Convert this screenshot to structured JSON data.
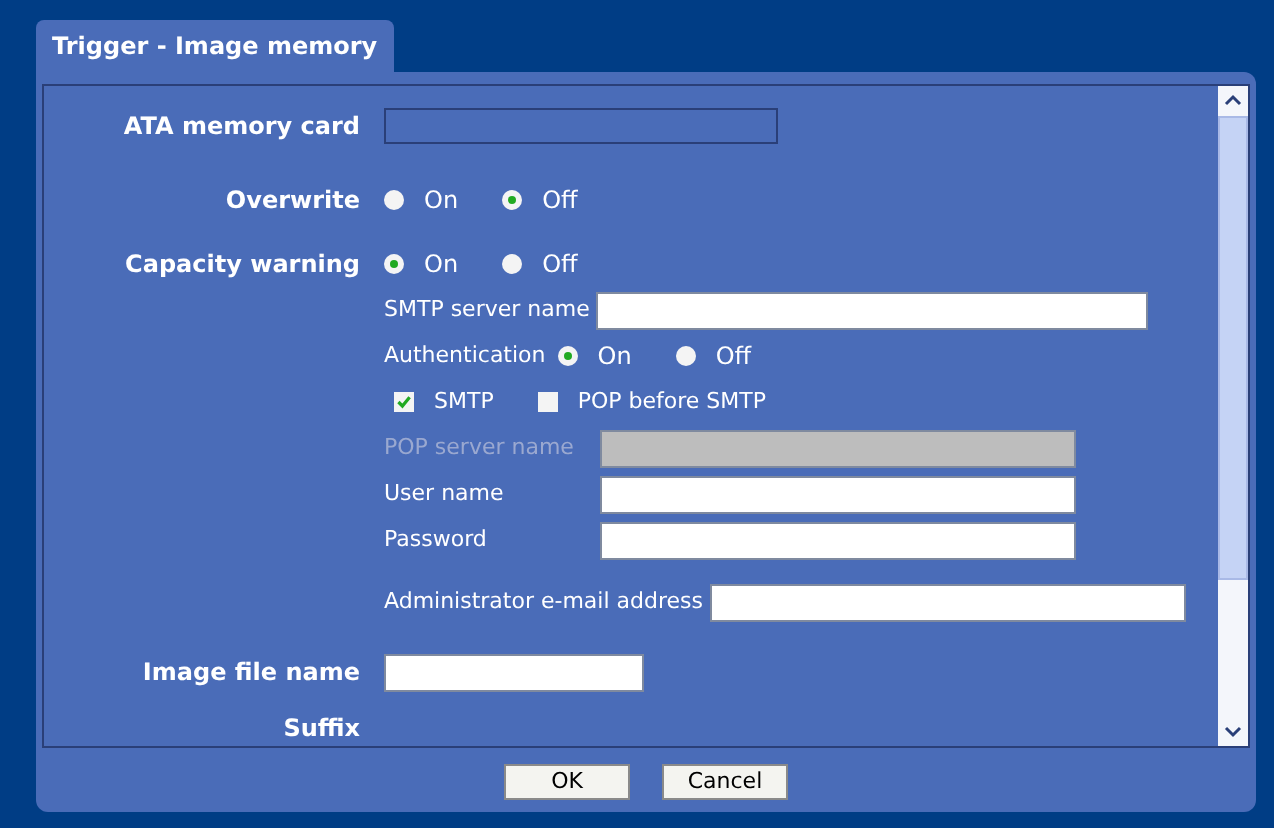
{
  "tab": {
    "label": "Trigger - Image memory",
    "selected": true
  },
  "ata_memory_card": {
    "label": "ATA memory card"
  },
  "overwrite": {
    "label": "Overwrite",
    "options": [
      {
        "label": "On",
        "selected": false
      },
      {
        "label": "Off",
        "selected": true
      }
    ]
  },
  "capacity_warning": {
    "label": "Capacity warning",
    "options": [
      {
        "label": "On",
        "selected": true
      },
      {
        "label": "Off",
        "selected": false
      }
    ]
  },
  "smtp_server_name": {
    "label": "SMTP server name"
  },
  "authentication": {
    "label": "Authentication",
    "options": [
      {
        "label": "On",
        "selected": true
      },
      {
        "label": "Off",
        "selected": false
      }
    ]
  },
  "auth_methods": [
    {
      "label": "SMTP",
      "checked": true
    },
    {
      "label": "POP before SMTP",
      "checked": false
    }
  ],
  "credentials": [
    {
      "label": "POP server name",
      "disabled": true
    },
    {
      "label": "User name",
      "disabled": false
    },
    {
      "label": "Password",
      "disabled": false
    }
  ],
  "admin_email": {
    "label": "Administrator e-mail address"
  },
  "image_file_name": {
    "label": "Image file name"
  },
  "suffix": {
    "label": "Suffix"
  },
  "buttons": [
    "OK",
    "Cancel"
  ]
}
